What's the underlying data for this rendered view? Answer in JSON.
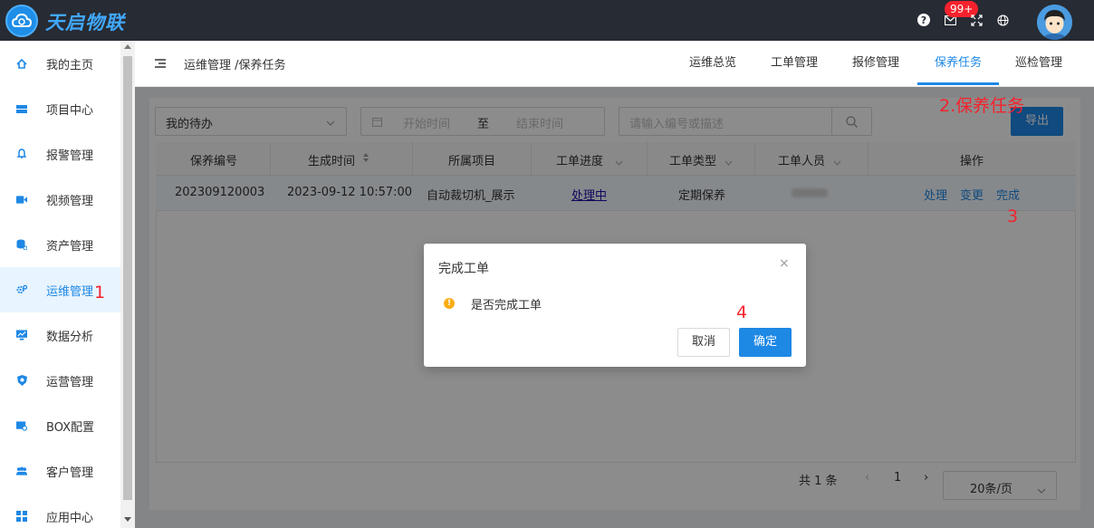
{
  "app": {
    "brand": "天启物联",
    "notification_count": "99+"
  },
  "topbar": {
    "icons": [
      "help-icon",
      "mail-icon",
      "fullscreen-icon",
      "globe-icon",
      "avatar"
    ]
  },
  "sidebar": {
    "items": [
      {
        "label": "我的主页",
        "icon": "home-icon"
      },
      {
        "label": "项目中心",
        "icon": "project-icon"
      },
      {
        "label": "报警管理",
        "icon": "bell-icon"
      },
      {
        "label": "视频管理",
        "icon": "video-icon"
      },
      {
        "label": "资产管理",
        "icon": "asset-icon"
      },
      {
        "label": "运维管理",
        "icon": "gear-icon",
        "active": true
      },
      {
        "label": "数据分析",
        "icon": "monitor-icon"
      },
      {
        "label": "运营管理",
        "icon": "shield-icon"
      },
      {
        "label": "BOX配置",
        "icon": "box-icon"
      },
      {
        "label": "客户管理",
        "icon": "users-icon"
      },
      {
        "label": "应用中心",
        "icon": "apps-icon"
      }
    ]
  },
  "annotations": {
    "a1": "1",
    "a2": "2.保养任务",
    "a3": "3",
    "a4": "4"
  },
  "header": {
    "breadcrumb": "运维管理 /保养任务",
    "tabs": [
      "运维总览",
      "工单管理",
      "报修管理",
      "保养任务",
      "巡检管理"
    ]
  },
  "filters": {
    "status_select": "我的待办",
    "start_placeholder": "开始时间",
    "range_sep": "至",
    "end_placeholder": "结束时间",
    "search_placeholder": "请输入编号或描述",
    "export_label": "导出"
  },
  "table": {
    "columns": [
      "保养编号",
      "生成时间",
      "所属项目",
      "工单进度",
      "工单类型",
      "工单人员",
      "操作"
    ],
    "rows": [
      {
        "id": "202309120003",
        "time": "2023-09-12 10:57:00",
        "project": "自动裁切机_展示",
        "progress": "处理中",
        "type": "定期保养",
        "actions": [
          "处理",
          "变更",
          "完成"
        ]
      }
    ]
  },
  "pagination": {
    "total": "共 1 条",
    "page": "1",
    "page_size": "20条/页"
  },
  "modal": {
    "title": "完成工单",
    "message": "是否完成工单",
    "cancel": "取消",
    "ok": "确定"
  },
  "colors": {
    "primary": "#1e88e5",
    "topbar": "#272b33",
    "annotation": "#f5222d"
  }
}
